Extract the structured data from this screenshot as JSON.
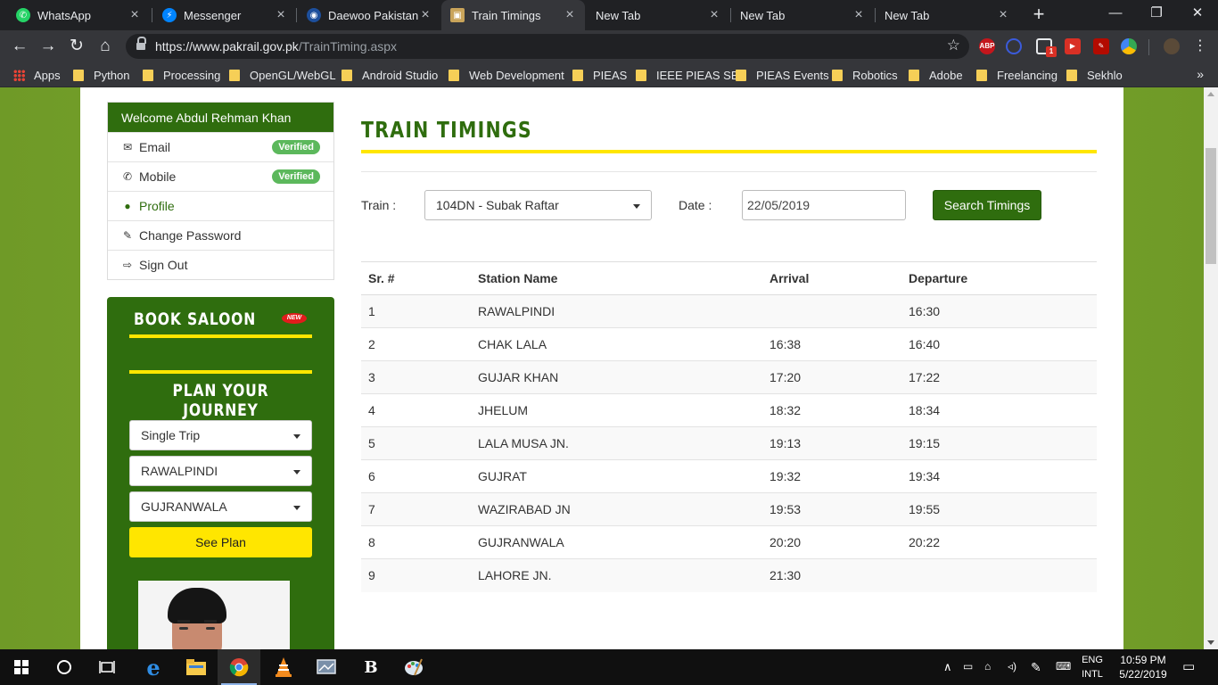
{
  "browser": {
    "tabs": [
      {
        "title": "WhatsApp",
        "icon": "whatsapp-icon",
        "color": "#25d366"
      },
      {
        "title": "Messenger",
        "icon": "messenger-icon",
        "color": "#0084ff"
      },
      {
        "title": "Daewoo Pakistan E",
        "icon": "daewoo-icon",
        "color": "#1d4f9c"
      },
      {
        "title": "Train Timings",
        "icon": "pakrail-icon",
        "color": "#c9a45a"
      },
      {
        "title": "New Tab",
        "icon": "",
        "color": ""
      },
      {
        "title": "New Tab",
        "icon": "",
        "color": ""
      },
      {
        "title": "New Tab",
        "icon": "",
        "color": ""
      }
    ],
    "url_host": "https://www.pakrail.gov.pk",
    "url_path": "/TrainTiming.aspx",
    "extensions": [
      {
        "name": "adblock-icon",
        "label": "ABP",
        "color": "#c4161c"
      },
      {
        "name": "extension-search-icon",
        "label": "",
        "color": "#3b5bdb"
      },
      {
        "name": "notification-icon",
        "label": "1",
        "color": "#d93025"
      },
      {
        "name": "video-icon",
        "label": "",
        "color": "#d93025"
      },
      {
        "name": "pdf-icon",
        "label": "",
        "color": "#b30b00"
      },
      {
        "name": "google-drive-icon",
        "label": "",
        "color": "#34a853"
      }
    ],
    "bookmarks": [
      "Apps",
      "Python",
      "Processing",
      "OpenGL/WebGL",
      "Android Studio",
      "Web Development",
      "PIEAS",
      "IEEE PIEAS SB",
      "PIEAS Events",
      "Robotics",
      "Adobe",
      "Freelancing",
      "Sekhlo"
    ]
  },
  "account": {
    "welcome": "Welcome Abdul Rehman Khan",
    "items": [
      {
        "label": "Email",
        "icon": "envelope-icon",
        "badge": "Verified"
      },
      {
        "label": "Mobile",
        "icon": "phone-icon",
        "badge": "Verified"
      },
      {
        "label": "Profile",
        "icon": "user-icon",
        "badge": ""
      },
      {
        "label": "Change Password",
        "icon": "edit-icon",
        "badge": ""
      },
      {
        "label": "Sign Out",
        "icon": "signout-icon",
        "badge": ""
      }
    ]
  },
  "booking": {
    "saloon_title": "BOOK SALOON",
    "new_badge": "NEW",
    "plan_title": "PLAN YOUR JOURNEY",
    "trip_type": "Single Trip",
    "from": "RAWALPINDI",
    "to": "GUJRANWALA",
    "see_plan": "See Plan"
  },
  "main": {
    "title": "TRAIN TIMINGS",
    "train_label": "Train :",
    "train_value": "104DN - Subak Raftar",
    "date_label": "Date :",
    "date_value": "22/05/2019",
    "search_label": "Search Timings",
    "columns": [
      "Sr. #",
      "Station Name",
      "Arrival",
      "Departure"
    ],
    "rows": [
      [
        "1",
        "RAWALPINDI",
        "",
        "16:30"
      ],
      [
        "2",
        "CHAK LALA",
        "16:38",
        "16:40"
      ],
      [
        "3",
        "GUJAR KHAN",
        "17:20",
        "17:22"
      ],
      [
        "4",
        "JHELUM",
        "18:32",
        "18:34"
      ],
      [
        "5",
        "LALA MUSA JN.",
        "19:13",
        "19:15"
      ],
      [
        "6",
        "GUJRAT",
        "19:32",
        "19:34"
      ],
      [
        "7",
        "WAZIRABAD JN",
        "19:53",
        "19:55"
      ],
      [
        "8",
        "GUJRANWALA",
        "20:20",
        "20:22"
      ],
      [
        "9",
        "LAHORE JN.",
        "21:30",
        ""
      ]
    ]
  },
  "taskbar": {
    "lang_top": "ENG",
    "lang_bottom": "INTL",
    "time": "10:59 PM",
    "date": "5/22/2019"
  },
  "colors": {
    "brand_green": "#2f6d0e",
    "accent_yellow": "#ffe600",
    "verified_green": "#5cb85c"
  }
}
